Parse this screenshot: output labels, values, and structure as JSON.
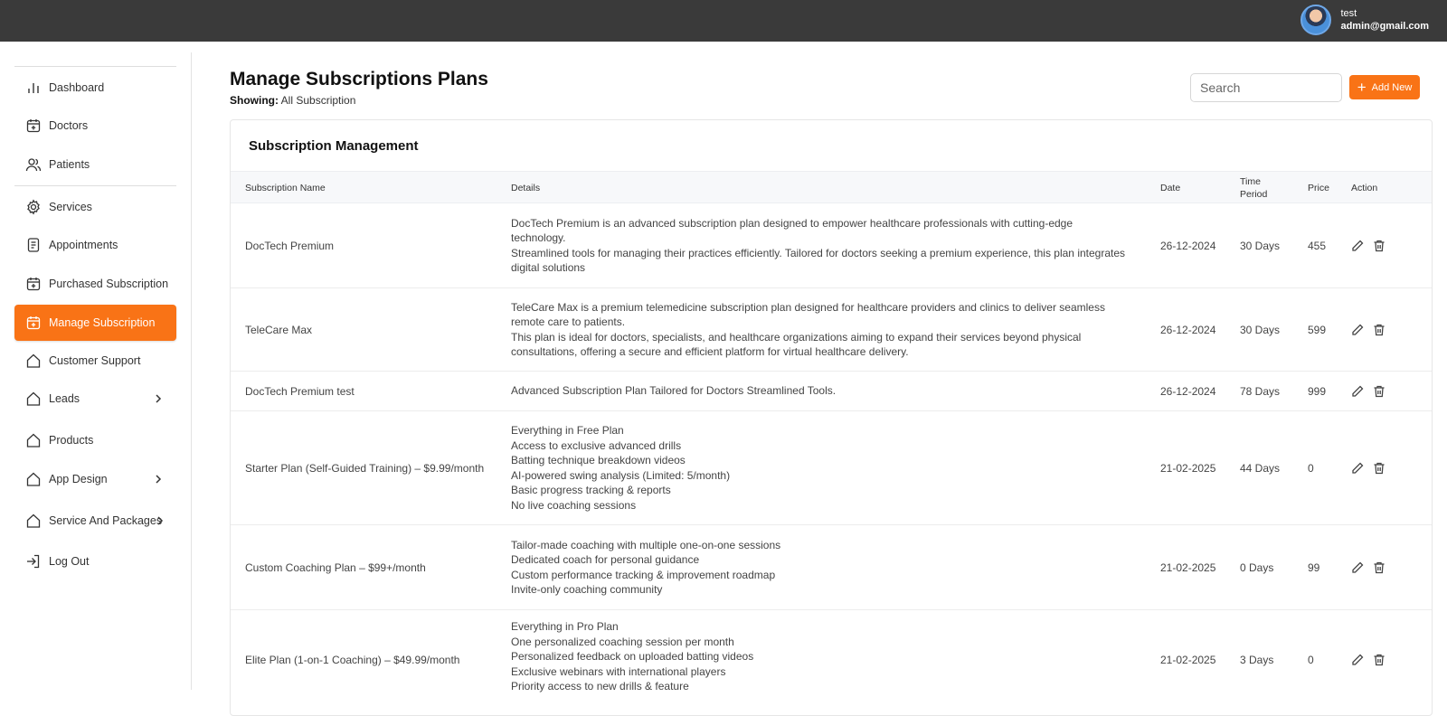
{
  "user": {
    "name": "test",
    "email": "admin@gmail.com"
  },
  "sidebar": {
    "items": [
      {
        "label": "Dashboard",
        "icon": "bar-chart-icon"
      },
      {
        "label": "Doctors",
        "icon": "calendar-plus-icon"
      },
      {
        "label": "Patients",
        "icon": "users-icon"
      },
      {
        "label": "Services",
        "icon": "gear-icon"
      },
      {
        "label": "Appointments",
        "icon": "document-icon"
      },
      {
        "label": "Purchased Subscription",
        "icon": "calendar-plus-icon"
      },
      {
        "label": "Manage Subscription",
        "icon": "calendar-plus-icon",
        "active": true
      },
      {
        "label": "Customer Support",
        "icon": "home-icon"
      },
      {
        "label": "Leads",
        "icon": "home-icon",
        "expandable": true
      },
      {
        "label": "Products",
        "icon": "home-icon"
      },
      {
        "label": "App Design",
        "icon": "home-icon",
        "expandable": true
      },
      {
        "label": "Service And Packages",
        "icon": "home-icon",
        "expandable": true
      },
      {
        "label": "Log Out",
        "icon": "logout-icon"
      }
    ]
  },
  "header": {
    "title": "Manage Subscriptions Plans",
    "showing_label": "Showing:",
    "showing_value": "All Subscription",
    "search_placeholder": "Search",
    "add_label": "Add New"
  },
  "card": {
    "title": "Subscription Management"
  },
  "table": {
    "columns": [
      "Subscription Name",
      "Details",
      "Date",
      "Time Period",
      "Price",
      "Action"
    ],
    "rows": [
      {
        "name": "DocTech Premium",
        "details": [
          "DocTech Premium is an advanced subscription plan designed to empower healthcare professionals with cutting-edge technology.",
          "Streamlined tools for managing their practices efficiently. Tailored for doctors seeking a premium experience, this plan integrates digital solutions"
        ],
        "date": "26-12-2024",
        "period": "30 Days",
        "price": "455"
      },
      {
        "name": "TeleCare Max",
        "details": [
          "TeleCare Max is a premium telemedicine subscription plan designed for healthcare providers and clinics to deliver seamless remote care to patients.",
          "This plan is ideal for doctors, specialists, and healthcare organizations aiming to expand their services beyond physical consultations, offering a secure and efficient platform for virtual healthcare delivery."
        ],
        "date": "26-12-2024",
        "period": "30 Days",
        "price": "599"
      },
      {
        "name": "DocTech Premium test",
        "details": [
          "Advanced Subscription Plan Tailored for Doctors Streamlined Tools."
        ],
        "date": "26-12-2024",
        "period": "78 Days",
        "price": "999"
      },
      {
        "name": "Starter Plan (Self-Guided Training) – $9.99/month",
        "details": [
          "Everything in Free Plan",
          "Access to exclusive advanced drills",
          "Batting technique breakdown videos",
          "AI-powered swing analysis (Limited: 5/month)",
          "Basic progress tracking & reports",
          "No live coaching sessions"
        ],
        "date": "21-02-2025",
        "period": "44 Days",
        "price": "0"
      },
      {
        "name": "Custom Coaching Plan – $99+/month",
        "details": [
          "Tailor-made coaching with multiple one-on-one sessions",
          "Dedicated coach for personal guidance",
          "Custom performance tracking & improvement roadmap",
          "Invite-only coaching community"
        ],
        "date": "21-02-2025",
        "period": "0 Days",
        "price": "99"
      },
      {
        "name": "Elite Plan (1-on-1 Coaching) – $49.99/month",
        "details": [
          "Everything in Pro Plan",
          "One personalized coaching session per month",
          "Personalized feedback on uploaded batting videos",
          "Exclusive webinars with international players",
          "Priority access to new drills & feature"
        ],
        "date": "21-02-2025",
        "period": "3 Days",
        "price": "0"
      }
    ]
  },
  "colors": {
    "accent": "#f97316",
    "topbar": "#3a3a3a"
  }
}
